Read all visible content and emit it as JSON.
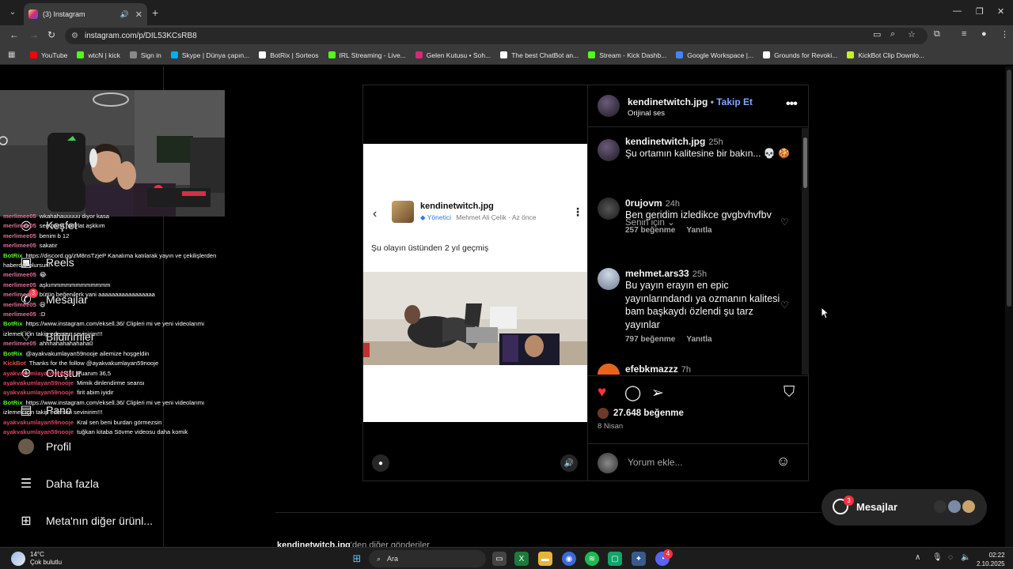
{
  "browser": {
    "tab_title": "(3) Instagram",
    "url": "instagram.com/p/DIL53KCsRB8",
    "bookmarks": [
      {
        "label": "YouTube",
        "color": "#ff0000"
      },
      {
        "label": "wtcN | kick",
        "color": "#53fc18"
      },
      {
        "label": "Sign in",
        "color": "#888888"
      },
      {
        "label": "Skype | Dünya çapın...",
        "color": "#00aff0"
      },
      {
        "label": "BotRix | Sorteos",
        "color": "#ffffff"
      },
      {
        "label": "IRL Streaming - Live...",
        "color": "#53fc18"
      },
      {
        "label": "Gelen Kutusu • Soh...",
        "color": "#d62976"
      },
      {
        "label": "The best ChatBot an...",
        "color": "#ffffff"
      },
      {
        "label": "Stream - Kick Dashb...",
        "color": "#53fc18"
      },
      {
        "label": "Google Workspace |...",
        "color": "#4285f4"
      },
      {
        "label": "Grounds for Revoki...",
        "color": "#ffffff"
      },
      {
        "label": "KickBot Clip Downlo...",
        "color": "#c8f02a"
      }
    ]
  },
  "sidenav": {
    "items": [
      {
        "label": "Keşfet",
        "icon": "compass-icon"
      },
      {
        "label": "Reels",
        "icon": "reels-icon"
      },
      {
        "label": "Mesajlar",
        "icon": "messenger-icon",
        "badge": "3"
      },
      {
        "label": "Bildirimler",
        "icon": "heart-icon"
      },
      {
        "label": "Oluştur",
        "icon": "plus-icon"
      },
      {
        "label": "Pano",
        "icon": "dashboard-icon"
      },
      {
        "label": "Profil",
        "icon": "profile-icon"
      },
      {
        "label": "Daha fazla",
        "icon": "menu-icon"
      },
      {
        "label": "Meta'nın diğer ürünl...",
        "icon": "grid-icon"
      }
    ]
  },
  "chat": [
    {
      "user": "merlimee05",
      "color": "#e0709a",
      "text": "wkahahauuuuu diyor kasa"
    },
    {
      "user": "merlimee05",
      "color": "#e0709a",
      "text": "sen bana hatırlat aşkkım"
    },
    {
      "user": "merlimee05",
      "color": "#e0709a",
      "text": "benim b 12"
    },
    {
      "user": "merlimee05",
      "color": "#e0709a",
      "text": "sakatır"
    },
    {
      "user": "BotRix",
      "color": "#53fc18",
      "text": "https://discord.gg/zM8nsTzjeP Kanalıma katılarak yayın ve çekilişlerden haberdar olursun!",
      "wrap": true
    },
    {
      "user": "merlimee05",
      "color": "#e0709a",
      "text": "😂"
    },
    {
      "user": "merlimee05",
      "color": "#e0709a",
      "text": "aşkımmmmmmmmmmmm"
    },
    {
      "user": "merlimee05",
      "color": "#e0709a",
      "text": "bütün beğenilerk yani aaaaaaaaaaaaaaaaa"
    },
    {
      "user": "merlimee05",
      "color": "#e0709a",
      "text": "😆"
    },
    {
      "user": "merlimee05",
      "color": "#e0709a",
      "text": ":D"
    },
    {
      "user": "BotRix",
      "color": "#53fc18",
      "text": "https://www.instagram.com/eksell.36/ Clipleri mi ve yeni videolarımı izlemek için takip edersen sevinirim!!!",
      "wrap": true
    },
    {
      "user": "merlimee05",
      "color": "#e0709a",
      "text": "ahhhahahahahaha0"
    },
    {
      "user": "BotRix",
      "color": "#53fc18",
      "text": "@ayakvakumlayan59nooje ailemize hoşgeldin"
    },
    {
      "user": "KickBot",
      "color": "#e05050",
      "text": "Thanks for the follow @ayakvakumlayan59nooje"
    },
    {
      "user": "ayakvakumlayan59nooje",
      "color": "#e04060",
      "text": "Puanım 36,5"
    },
    {
      "user": "ayakvakumlayan59nooje",
      "color": "#e04060",
      "text": "Mimik dinlendirme seansı"
    },
    {
      "user": "ayakvakumlayan59nooje",
      "color": "#e04060",
      "text": "firit abim iyidir"
    },
    {
      "user": "BotRix",
      "color": "#53fc18",
      "text": "https://www.instagram.com/eksell.36/ Clipleri mi ve yeni videolarımı izlemek için takip edersen sevinirim!!!",
      "wrap": true
    },
    {
      "user": "ayakvakumlayan59nooje",
      "color": "#e04060",
      "text": "Kral sen beni burdan görmezsin"
    },
    {
      "user": "ayakvakumlayan59nooje",
      "color": "#e04060",
      "text": "tuğkan kitaba Sövme videosu daha komik"
    }
  ],
  "post": {
    "card": {
      "username": "kendinetwitch.jpg",
      "role": "Yönetici",
      "author": "Mehmet Ali Çelik",
      "time": "Az önce",
      "text": "Şu olayın üstünden 2 yıl geçmiş"
    },
    "header": {
      "username": "kendinetwitch.jpg",
      "follow": "Takip Et",
      "audio": "Orijinal ses"
    },
    "caption": {
      "username": "kendinetwitch.jpg",
      "time": "25h",
      "text": "Şu ortamın kalitesine bir bakın... 💀 🍪"
    },
    "sort_label": "Senin için",
    "comments": [
      {
        "username": "0rujovm",
        "time": "24h",
        "text": "Ben geridim izledikce gvgbvhvfbv",
        "likes": "257 beğenme",
        "reply": "Yanıtla"
      },
      {
        "username": "mehmet.ars33",
        "time": "25h",
        "text": "Bu yayın erayın en epic yayınlarındandı ya ozmanın kalitesi bam başkaydı özlendi şu tarz yayınlar",
        "likes": "797 beğenme",
        "reply": "Yanıtla"
      },
      {
        "username": "efebkmazzz",
        "time": "7h",
        "text": "",
        "likes": "",
        "reply": ""
      }
    ],
    "likes": "27.648 beğenme",
    "date": "8 Nisan",
    "comment_placeholder": "Yorum ekle..."
  },
  "more_posts": {
    "username": "kendinetwitch.jpg",
    "suffix": "'den diğer gönderiler"
  },
  "messages_button": {
    "label": "Mesajlar",
    "badge": "3"
  },
  "taskbar": {
    "temperature": "14°C",
    "weather": "Çok bulutlu",
    "search": "Ara",
    "time": "02:22",
    "date": "2.10.2025",
    "discord_badge": "4"
  }
}
